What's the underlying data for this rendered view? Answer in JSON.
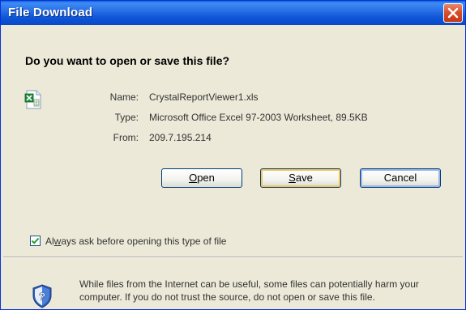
{
  "window": {
    "title": "File Download"
  },
  "dialog": {
    "question": "Do you want to open or save this file?",
    "fields": {
      "name_label": "Name:",
      "name_value": "CrystalReportViewer1.xls",
      "type_label": "Type:",
      "type_value": "Microsoft Office Excel 97-2003 Worksheet, 89.5KB",
      "from_label": "From:",
      "from_value": "209.7.195.214"
    },
    "buttons": {
      "open": {
        "pre": "",
        "key": "O",
        "post": "pen"
      },
      "save": {
        "pre": "",
        "key": "S",
        "post": "ave"
      },
      "cancel": "Cancel"
    },
    "checkbox": {
      "checked": true,
      "pre": "Al",
      "key": "w",
      "post": "ays ask before opening this type of file"
    },
    "warning": "While files from the Internet can be useful, some files can potentially harm your computer. If you do not trust the source, do not open or save this file."
  },
  "icons": {
    "file": "excel-file-icon",
    "shield": "security-shield-icon",
    "close": "close-icon"
  },
  "colors": {
    "titlebar": "#0a5fd8",
    "close": "#d9502b",
    "background": "#ece9d8"
  }
}
